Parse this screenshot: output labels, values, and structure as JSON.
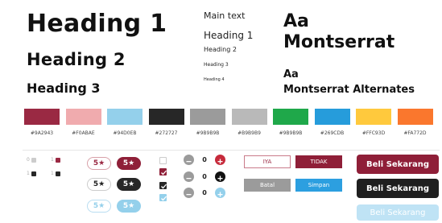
{
  "headings": {
    "h1": "Heading 1",
    "h2": "Heading 2",
    "h3": "Heading 3"
  },
  "type_samples": {
    "main_text": "Main text",
    "heading1": "Heading 1",
    "heading2": "Heading 2",
    "heading3": "Heading 3",
    "heading4": "Heading 4"
  },
  "fonts": {
    "primary_sample": "Aa",
    "primary_name": "Montserrat",
    "alt_sample": "Aa",
    "alt_name": "Montserrat Alternates"
  },
  "palette": [
    {
      "hex": "#9A2943",
      "color": "#9A2943"
    },
    {
      "hex": "#F0ABAE",
      "color": "#F0ABAE"
    },
    {
      "hex": "#94D0EB",
      "color": "#94D0EB"
    },
    {
      "hex": "#272727",
      "color": "#272727"
    },
    {
      "hex": "#9B9B9B",
      "color": "#9B9B9B"
    },
    {
      "hex": "#B9B9B9",
      "color": "#B9B9B9"
    },
    {
      "hex": "#9B9B9B",
      "color": "#1fa84a"
    },
    {
      "hex": "#269CDB",
      "color": "#269CDB"
    },
    {
      "hex": "#FFC93D",
      "color": "#FFC93D"
    },
    {
      "hex": "#FA772D",
      "color": "#FA772D"
    }
  ],
  "likes": {
    "row1_left": "0",
    "row1_right": "1",
    "row2_left": "1",
    "row2_right": "1"
  },
  "ratings": {
    "r1": "5★",
    "r2": "5★",
    "r3": "5★",
    "r4": "5★",
    "r5": "5★",
    "r6": "5★"
  },
  "steppers": {
    "s1": "0",
    "s2": "0",
    "s3": "0"
  },
  "buttons_small": {
    "iya": "IYA",
    "tidak": "TIDAK",
    "batal": "Batal",
    "simpan": "Simpan"
  },
  "buttons_large": {
    "b1": "Beli Sekarang",
    "b2": "Beli Sekarang",
    "b3": "Beli Sekarang"
  },
  "colors": {
    "brand": "#9A2943",
    "dark": "#272727",
    "light_blue": "#94D0EB"
  }
}
